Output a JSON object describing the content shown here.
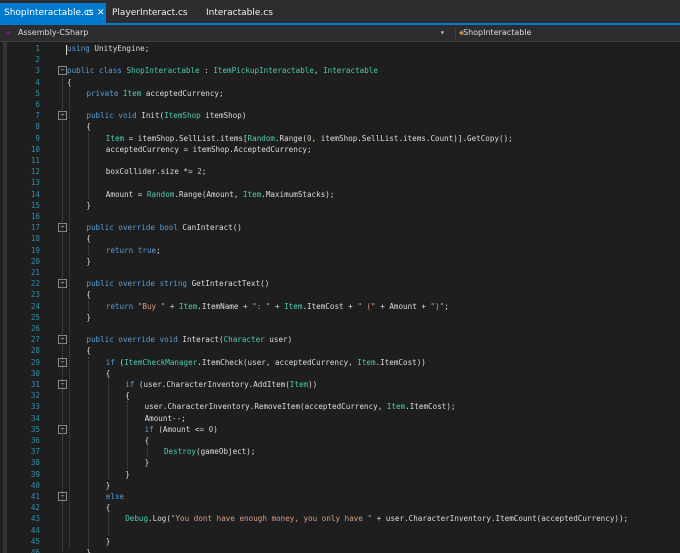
{
  "tabs": [
    {
      "label": "ShopInteractable.cs",
      "pin_glyph": "⊏",
      "close_glyph": "✕",
      "active": true
    },
    {
      "label": "PlayerInteract.cs",
      "pin_glyph": "",
      "close_glyph": "",
      "active": false
    },
    {
      "label": "Interactable.cs",
      "pin_glyph": "",
      "close_glyph": "",
      "active": false
    }
  ],
  "nav": {
    "project": "Assembly-CSharp",
    "class_member": "ShopInteractable",
    "dropdown_glyph": "▾"
  },
  "colors": {
    "keyword": "#569cd6",
    "type": "#4ec9b0",
    "string": "#d69d85",
    "line_number": "#2b91af",
    "active_tab": "#007acc"
  },
  "editor": {
    "lines": [
      {
        "n": "1",
        "i": 0,
        "t": [
          [
            "kw",
            "using"
          ],
          [
            "p",
            " UnityEngine;"
          ]
        ]
      },
      {
        "n": "2",
        "i": 0,
        "t": []
      },
      {
        "n": "3",
        "i": 0,
        "f": "−",
        "t": [
          [
            "kw",
            "public"
          ],
          [
            "p",
            " "
          ],
          [
            "kw",
            "class"
          ],
          [
            "p",
            " "
          ],
          [
            "ty",
            "ShopInteractable"
          ],
          [
            "p",
            " : "
          ],
          [
            "ty",
            "ItemPickupInteractable"
          ],
          [
            "p",
            ", "
          ],
          [
            "ty",
            "Interactable"
          ]
        ]
      },
      {
        "n": "4",
        "i": 0,
        "t": [
          [
            "p",
            "{"
          ]
        ]
      },
      {
        "n": "5",
        "i": 1,
        "t": [
          [
            "kw",
            "private"
          ],
          [
            "p",
            " "
          ],
          [
            "ty",
            "Item"
          ],
          [
            "p",
            " acceptedCurrency;"
          ]
        ]
      },
      {
        "n": "6",
        "i": 0,
        "t": []
      },
      {
        "n": "7",
        "i": 1,
        "f": "−",
        "t": [
          [
            "kw",
            "public"
          ],
          [
            "p",
            " "
          ],
          [
            "kw",
            "void"
          ],
          [
            "p",
            " Init("
          ],
          [
            "ty",
            "ItemShop"
          ],
          [
            "p",
            " itemShop)"
          ]
        ]
      },
      {
        "n": "8",
        "i": 1,
        "t": [
          [
            "p",
            "{"
          ]
        ]
      },
      {
        "n": "9",
        "i": 2,
        "t": [
          [
            "ty",
            "Item"
          ],
          [
            "p",
            " = itemShop.SellList.items["
          ],
          [
            "ty",
            "Random"
          ],
          [
            "p",
            ".Range("
          ],
          [
            "nu",
            "0"
          ],
          [
            "p",
            ", itemShop.SellList.items.Count)].GetCopy();"
          ]
        ]
      },
      {
        "n": "10",
        "i": 2,
        "t": [
          [
            "p",
            "acceptedCurrency = itemShop.AcceptedCurrency;"
          ]
        ]
      },
      {
        "n": "11",
        "i": 0,
        "t": []
      },
      {
        "n": "12",
        "i": 2,
        "t": [
          [
            "p",
            "boxCollider.size *= "
          ],
          [
            "nu",
            "2"
          ],
          [
            "p",
            ";"
          ]
        ]
      },
      {
        "n": "13",
        "i": 0,
        "t": []
      },
      {
        "n": "14",
        "i": 2,
        "t": [
          [
            "p",
            "Amount = "
          ],
          [
            "ty",
            "Random"
          ],
          [
            "p",
            ".Range(Amount, "
          ],
          [
            "ty",
            "Item"
          ],
          [
            "p",
            ".MaximumStacks);"
          ]
        ]
      },
      {
        "n": "15",
        "i": 1,
        "t": [
          [
            "p",
            "}"
          ]
        ]
      },
      {
        "n": "16",
        "i": 0,
        "t": []
      },
      {
        "n": "17",
        "i": 1,
        "f": "−",
        "t": [
          [
            "kw",
            "public"
          ],
          [
            "p",
            " "
          ],
          [
            "kw",
            "override"
          ],
          [
            "p",
            " "
          ],
          [
            "kw",
            "bool"
          ],
          [
            "p",
            " CanInteract()"
          ]
        ]
      },
      {
        "n": "18",
        "i": 1,
        "t": [
          [
            "p",
            "{"
          ]
        ]
      },
      {
        "n": "19",
        "i": 2,
        "t": [
          [
            "kw",
            "return"
          ],
          [
            "p",
            " "
          ],
          [
            "kw",
            "true"
          ],
          [
            "p",
            ";"
          ]
        ]
      },
      {
        "n": "20",
        "i": 1,
        "t": [
          [
            "p",
            "}"
          ]
        ]
      },
      {
        "n": "21",
        "i": 0,
        "t": []
      },
      {
        "n": "22",
        "i": 1,
        "f": "−",
        "t": [
          [
            "kw",
            "public"
          ],
          [
            "p",
            " "
          ],
          [
            "kw",
            "override"
          ],
          [
            "p",
            " "
          ],
          [
            "kw",
            "string"
          ],
          [
            "p",
            " GetInteractText()"
          ]
        ]
      },
      {
        "n": "23",
        "i": 1,
        "t": [
          [
            "p",
            "{"
          ]
        ]
      },
      {
        "n": "24",
        "i": 2,
        "t": [
          [
            "kw",
            "return"
          ],
          [
            "p",
            " "
          ],
          [
            "st",
            "\"Buy \""
          ],
          [
            "p",
            " + "
          ],
          [
            "ty",
            "Item"
          ],
          [
            "p",
            ".ItemName + "
          ],
          [
            "st",
            "\": \""
          ],
          [
            "p",
            " + "
          ],
          [
            "ty",
            "Item"
          ],
          [
            "p",
            ".ItemCost + "
          ],
          [
            "st",
            "\" (\""
          ],
          [
            "p",
            " + Amount + "
          ],
          [
            "st",
            "\")\""
          ],
          [
            "p",
            ";"
          ]
        ]
      },
      {
        "n": "25",
        "i": 1,
        "t": [
          [
            "p",
            "}"
          ]
        ]
      },
      {
        "n": "26",
        "i": 0,
        "t": []
      },
      {
        "n": "27",
        "i": 1,
        "f": "−",
        "t": [
          [
            "kw",
            "public"
          ],
          [
            "p",
            " "
          ],
          [
            "kw",
            "override"
          ],
          [
            "p",
            " "
          ],
          [
            "kw",
            "void"
          ],
          [
            "p",
            " Interact("
          ],
          [
            "ty",
            "Character"
          ],
          [
            "p",
            " user)"
          ]
        ]
      },
      {
        "n": "28",
        "i": 1,
        "t": [
          [
            "p",
            "{"
          ]
        ]
      },
      {
        "n": "29",
        "i": 2,
        "f": "−",
        "t": [
          [
            "kw",
            "if"
          ],
          [
            "p",
            " ("
          ],
          [
            "ty",
            "ItemCheckManager"
          ],
          [
            "p",
            ".ItemCheck(user, acceptedCurrency, "
          ],
          [
            "ty",
            "Item"
          ],
          [
            "p",
            ".ItemCost))"
          ]
        ]
      },
      {
        "n": "30",
        "i": 2,
        "t": [
          [
            "p",
            "{"
          ]
        ]
      },
      {
        "n": "31",
        "i": 3,
        "f": "−",
        "t": [
          [
            "kw",
            "if"
          ],
          [
            "p",
            " (user.CharacterInventory.AddItem("
          ],
          [
            "ty",
            "Item"
          ],
          [
            "p",
            "))"
          ]
        ]
      },
      {
        "n": "32",
        "i": 3,
        "t": [
          [
            "p",
            "{"
          ]
        ]
      },
      {
        "n": "33",
        "i": 4,
        "t": [
          [
            "p",
            "user.CharacterInventory.RemoveItem(acceptedCurrency, "
          ],
          [
            "ty",
            "Item"
          ],
          [
            "p",
            ".ItemCost);"
          ]
        ]
      },
      {
        "n": "34",
        "i": 4,
        "t": [
          [
            "p",
            "Amount--;"
          ]
        ]
      },
      {
        "n": "35",
        "i": 4,
        "f": "−",
        "t": [
          [
            "kw",
            "if"
          ],
          [
            "p",
            " (Amount <= "
          ],
          [
            "nu",
            "0"
          ],
          [
            "p",
            ")"
          ]
        ]
      },
      {
        "n": "36",
        "i": 4,
        "t": [
          [
            "p",
            "{"
          ]
        ]
      },
      {
        "n": "37",
        "i": 5,
        "t": [
          [
            "ty",
            "Destroy"
          ],
          [
            "p",
            "(gameObject);"
          ]
        ]
      },
      {
        "n": "38",
        "i": 4,
        "t": [
          [
            "p",
            "}"
          ]
        ]
      },
      {
        "n": "39",
        "i": 3,
        "t": [
          [
            "p",
            "}"
          ]
        ]
      },
      {
        "n": "40",
        "i": 2,
        "t": [
          [
            "p",
            "}"
          ]
        ]
      },
      {
        "n": "41",
        "i": 2,
        "f": "−",
        "t": [
          [
            "kw",
            "else"
          ]
        ]
      },
      {
        "n": "42",
        "i": 2,
        "t": [
          [
            "p",
            "{"
          ]
        ]
      },
      {
        "n": "43",
        "i": 3,
        "t": [
          [
            "ty",
            "Debug"
          ],
          [
            "p",
            ".Log("
          ],
          [
            "st",
            "\"You dont have enough money, you only have \""
          ],
          [
            "p",
            " + user.CharacterInventory.ItemCount(acceptedCurrency));"
          ]
        ]
      },
      {
        "n": "44",
        "i": 0,
        "t": []
      },
      {
        "n": "45",
        "i": 2,
        "t": [
          [
            "p",
            "}"
          ]
        ]
      },
      {
        "n": "46",
        "i": 1,
        "t": [
          [
            "p",
            "}"
          ]
        ]
      }
    ]
  }
}
